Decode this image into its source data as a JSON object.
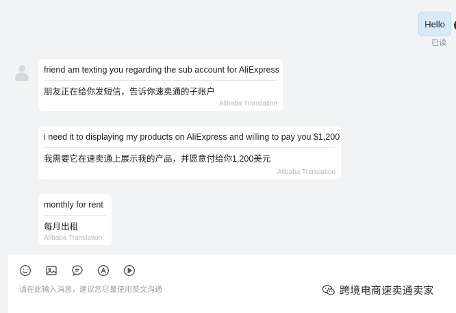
{
  "outgoing": {
    "text": "Hello",
    "status": "已读"
  },
  "messages": [
    {
      "original": "friend am texting you regarding the sub account for AliExpress",
      "translated": "朋友正在给你发短信，告诉你速卖通的子账户",
      "label": "Alibaba Translation"
    },
    {
      "original": "i need it to displaying my products on AliExpress and willing to pay you $1,200",
      "translated": "我需要它在速卖通上展示我的产品，并愿意付给你1,200美元",
      "label": "Alibaba Translation"
    },
    {
      "original": "monthly for rent",
      "translated": "每月出租",
      "label": "Alibaba Translation"
    }
  ],
  "composer": {
    "placeholder": "请在此输入消息，建议您尽量使用英文沟通",
    "tools": [
      "emoji-icon",
      "image-icon",
      "quick-reply-icon",
      "translate-icon",
      "video-icon"
    ]
  },
  "watermark": {
    "text": "跨境电商速卖通卖家",
    "icon": "wechat-icon"
  }
}
